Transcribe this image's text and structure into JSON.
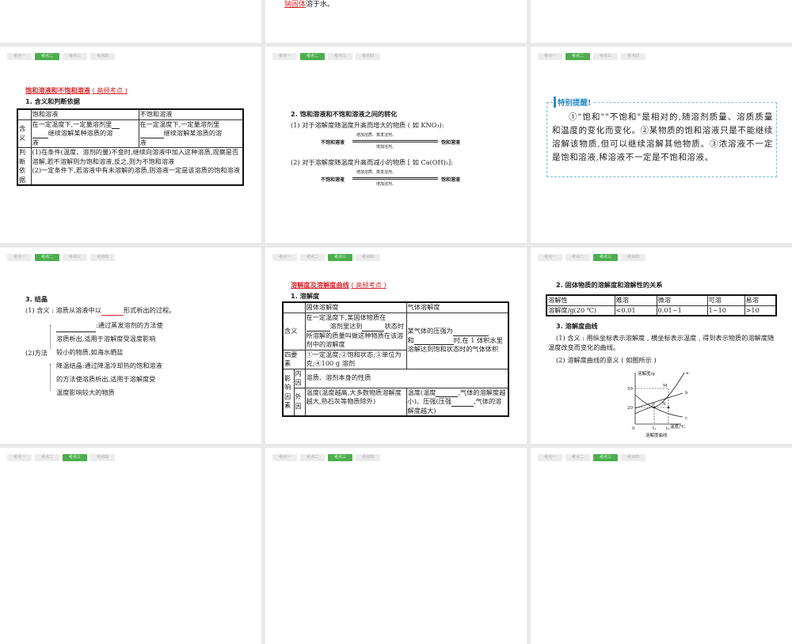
{
  "tabs": [
    "考点一",
    "考点二",
    "考点三",
    "考点四"
  ],
  "slide_top_middle": {
    "blank": "钠固体",
    "text": "溶于水。"
  },
  "slide1": {
    "title": "饱和溶液和不饱和溶液",
    "tag": "( 高频考点 )",
    "heading": "1. 含义和判断依据",
    "table": {
      "headers": [
        "",
        "饱和溶液",
        "不饱和溶液"
      ],
      "row1_label": "含义",
      "row1_col1": [
        "在一定温度下,一定量溶剂里",
        "继续溶解某种溶质的溶",
        "液"
      ],
      "row1_col2": [
        "在一定温度下,一定量溶剂里",
        "继续溶解某溶质的溶",
        "液"
      ],
      "row2_label": "判断依据",
      "row2_text1": "(1)在条件(温度、溶剂的量)不变时,继续向溶液中加入这种溶质,观察是否溶解,若不溶解则为饱和溶液,反之,则为不饱和溶液",
      "row2_text2": "(2)一定条件下,若溶液中有未溶解的溶质,则溶液一定是该溶质的饱和溶液"
    }
  },
  "slide2": {
    "heading": "2. 饱和溶液和不饱和溶液之间的转化",
    "p1": "(1) 对于溶解度随温度升高而增大的物质 ( 如 KNO₃):",
    "p2": "(2) 对于溶解度随温度升高而减小的物质 [ 如 Ca(OH)₂]:",
    "left": "不饱和溶液",
    "right": "饱和溶液",
    "top_arrow": "增加溶质、蒸发溶剂、",
    "bottom_arrow": "增加溶剂、"
  },
  "slide3": {
    "title": "特别提醒!",
    "body": "①\"饱和\"\"不饱和\"是相对的,随溶剂质量、溶质质量和温度的变化而变化。②某物质的饱和溶液只是不能继续溶解该物质,但可以继续溶解其他物质。③浓溶液不一定是饱和溶液,稀溶液不一定是不饱和溶液。"
  },
  "slide4": {
    "heading": "3. 结晶",
    "p1a": "(1) 含义 : 溶质从溶液中以",
    "p1b": "形式析出的过程。",
    "method_label": "(2)方法",
    "m1a": ":通过蒸发溶剂的方法使",
    "m1b": "溶质析出,适用于溶解度受温度影响",
    "m1c": "较小的物质,如海水晒盐",
    "m2a": "降温结晶:通过降温冷却热的饱和溶液",
    "m2b": "的方法使溶质析出,适用于溶解度受",
    "m2c": "温度影响较大的物质"
  },
  "slide5": {
    "title": "溶解度及溶解度曲线",
    "tag": "( 高频考点 )",
    "heading": "1. 溶解度",
    "headers": [
      "固体溶解度",
      "气体溶解度"
    ],
    "r1_label": "含义",
    "r1_solid": [
      "在一定温度下,某固体物质在",
      "溶剂里达到",
      "状态时所溶解的质量叫做这种物质在该溶剂中的溶解度"
    ],
    "gas": [
      "某气体的压强为",
      "和",
      "时,在 1 体积水里溶解达到饱和状态时的气体体积"
    ],
    "r2_label": "四要素",
    "r2_solid": "①一定温度;②饱和状态;③单位为克;④100 g 溶剂",
    "r3_label": "影响因素",
    "inner": "内因",
    "inner_text": "溶质、溶剂本身的性质",
    "outer": "外因",
    "outer_solid": "温度(温度越高,大多数物质溶解度越大,熟石灰等物质除外)",
    "outer_gas": [
      "温度(温度",
      ",气体的溶解度越小)、压强(压强",
      ",气体的溶解度越大)"
    ]
  },
  "slide6": {
    "heading": "2. 固体物质的溶解度和溶解性的关系",
    "table_rows": [
      [
        "溶解性",
        "难溶",
        "微溶",
        "可溶",
        "易溶"
      ],
      [
        "溶解度/g(20 ℃)",
        "<0.01",
        "0.01~1",
        "1~10",
        ">10"
      ]
    ],
    "heading3": "3. 溶解度曲线",
    "p1": "(1) 含义 : 用纵坐标表示溶解度 , 横坐标表示温度 , 得到表示物质的溶解度随温度改变而变化的曲线。",
    "p2": "(2) 溶解度曲线的意义 ( 如图所示 )",
    "graph": {
      "ylabel": "溶解度/g",
      "xlabel": "温度/℃",
      "origin": "0",
      "y50": "50",
      "y20": "20",
      "t1": "t₁",
      "t2": "t₂",
      "a": "a",
      "b": "b",
      "c": "c",
      "M": "M",
      "N": "N",
      "P": "P",
      "caption": "溶解度曲线"
    }
  }
}
